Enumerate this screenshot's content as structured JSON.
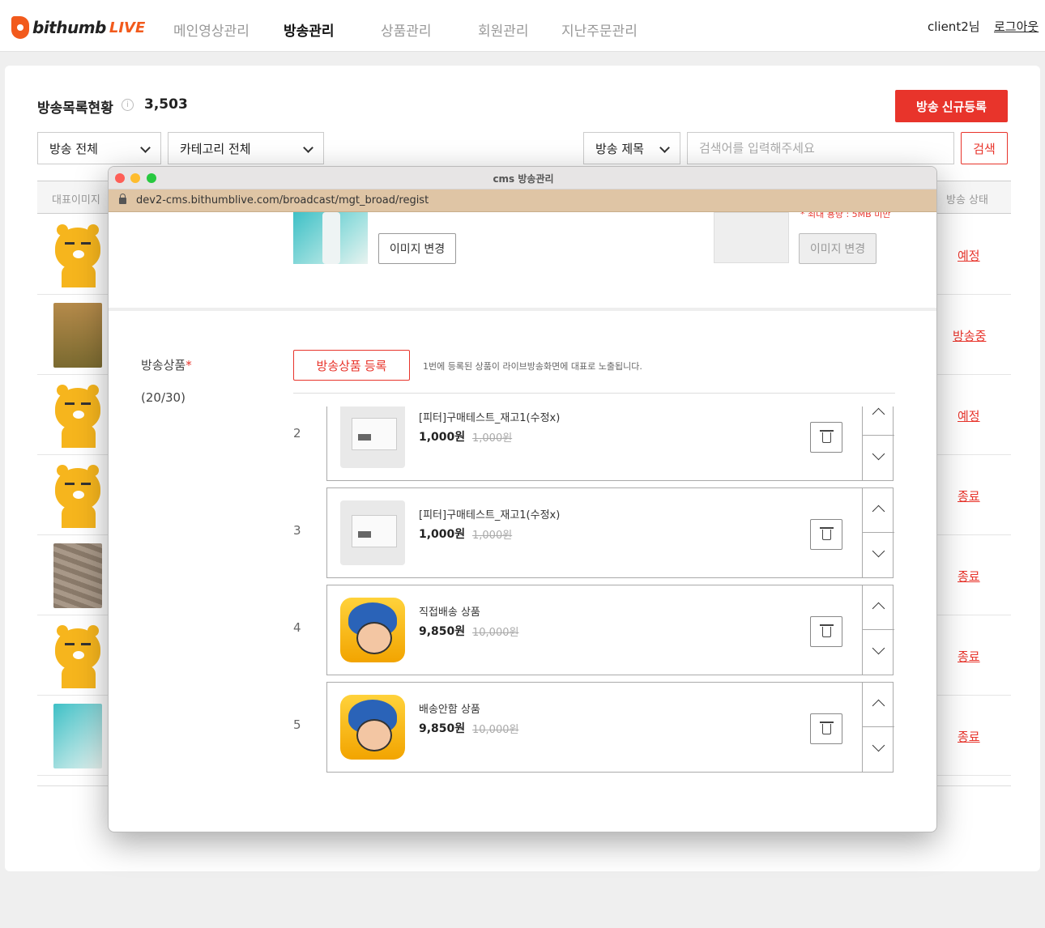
{
  "header": {
    "logo_text": "bithumb",
    "logo_live": "LIVE",
    "nav": [
      "메인영상관리",
      "방송관리",
      "상품관리",
      "회원관리",
      "지난주문관리"
    ],
    "active_nav": "방송관리",
    "user": "client2님",
    "logout": "로그아웃"
  },
  "list": {
    "title": "방송목록현황",
    "info_icon": "i",
    "count": "3,503",
    "new_button": "방송 신규등록",
    "filter_broadcast": "방송 전체",
    "filter_category": "카테고리 전체",
    "search_type": "방송 제목",
    "search_placeholder": "검색어를 입력해주세요",
    "search_button": "검색",
    "col_image": "대표이미지",
    "col_status": "방송 상태",
    "rows": [
      {
        "thumb": "ryan",
        "status": "예정"
      },
      {
        "thumb": "painting",
        "status": "방송중"
      },
      {
        "thumb": "ryan",
        "status": "예정"
      },
      {
        "thumb": "ryan",
        "status": "종료"
      },
      {
        "thumb": "brick",
        "status": "종료"
      },
      {
        "thumb": "ryan",
        "status": "종료"
      },
      {
        "thumb": "fashion",
        "status": "종료"
      }
    ]
  },
  "browser": {
    "window_title": "cms 방송관리",
    "url": "dev2-cms.bithumblive.com/broadcast/mgt_broad/regist"
  },
  "form": {
    "image_change": "이미지 변경",
    "image_change_disabled": "이미지 변경",
    "size_note": "* 최대 용량 : 5MB 미만",
    "product_label": "방송상품",
    "required_mark": "*",
    "product_count": "(20/30)",
    "register_button": "방송상품 등록",
    "register_note": "1번에 등록된 상품이 라이브방송화면에 대표로 노출됩니다.",
    "items": [
      {
        "index": "2",
        "name": "[피터]구매테스트_재고1(수정x)",
        "price": "1,000원",
        "original": "1,000원",
        "img": "paper"
      },
      {
        "index": "3",
        "name": "[피터]구매테스트_재고1(수정x)",
        "price": "1,000원",
        "original": "1,000원",
        "img": "paper"
      },
      {
        "index": "4",
        "name": "직접배송 상품",
        "price": "9,850원",
        "original": "10,000원",
        "img": "game"
      },
      {
        "index": "5",
        "name": "배송안함 상품",
        "price": "9,850원",
        "original": "10,000원",
        "img": "game"
      }
    ]
  }
}
